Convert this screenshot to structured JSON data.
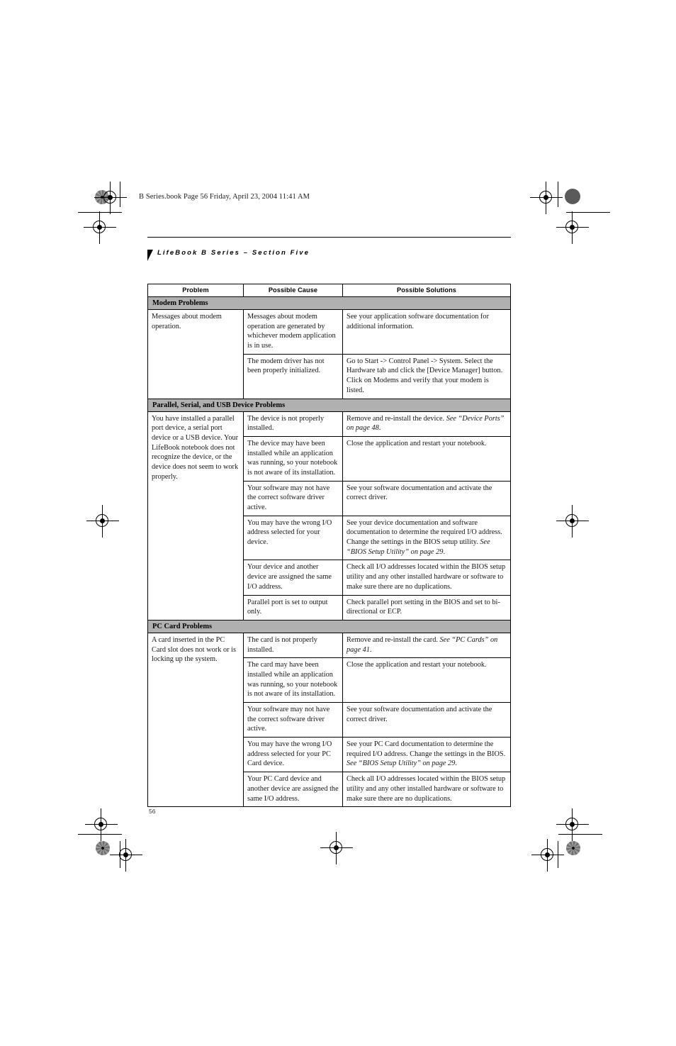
{
  "crop_marks": {
    "book_stamp": "B Series.book  Page 56  Friday, April 23, 2004  11:41 AM"
  },
  "running_head": {
    "text": "LifeBook B Series – Section Five"
  },
  "folio": {
    "page_number": "56"
  },
  "colors": {
    "section_header_fill": "#b0b0b0",
    "rule": "#000000",
    "text": "#161616"
  },
  "table": {
    "headers": {
      "problem": "Problem",
      "cause": "Possible Cause",
      "solution": "Possible Solutions"
    },
    "sections": [
      {
        "title": "Modem Problems",
        "groups": [
          {
            "problem": "Messages about modem operation.",
            "rows": [
              {
                "cause": "Messages about modem operation are generated by whichever modem application is in use.",
                "solution": "See your application software documentation for additional information.",
                "solution_ref": ""
              },
              {
                "cause": "The modem driver has not been properly initialized.",
                "solution": "Go to Start -> Control Panel -> System. Select the Hardware tab and click the [Device Manager] button. Click on Modems and verify that your modem is listed.",
                "solution_ref": ""
              }
            ]
          }
        ]
      },
      {
        "title": "Parallel, Serial, and USB Device Problems",
        "groups": [
          {
            "problem": "You have installed a parallel port device, a serial port device or a USB device. Your LifeBook notebook does not recognize the device, or the device does not seem to work properly.",
            "rows": [
              {
                "cause": "The device is not properly installed.",
                "solution": "Remove and re-install the device. ",
                "solution_ref": "See “Device Ports” on page 48",
                "solution_tail": "."
              },
              {
                "cause": "The device may have been installed while an application was running, so your notebook is not aware of its installation.",
                "solution": "Close the application and restart your notebook.",
                "solution_ref": ""
              },
              {
                "cause": "Your software may not have the correct software driver active.",
                "solution": "See your software documentation and activate the correct driver.",
                "solution_ref": ""
              },
              {
                "cause": "You may have the wrong I/O address selected for your device.",
                "solution": "See your device documentation and software documentation to determine the required I/O address. Change the settings in the BIOS setup utility. ",
                "solution_ref": "See “BIOS Setup Utility” on page 29",
                "solution_tail": "."
              },
              {
                "cause": "Your device and another device are assigned the same I/O address.",
                "solution": "Check all I/O addresses located within the BIOS setup utility and any other installed hardware or software to make sure there are no duplications.",
                "solution_ref": ""
              },
              {
                "cause": "Parallel port is set to output only.",
                "solution": "Check parallel port setting in the BIOS and set to bi-directional or ECP.",
                "solution_ref": ""
              }
            ]
          }
        ]
      },
      {
        "title": "PC Card Problems",
        "groups": [
          {
            "problem": "A card inserted in the PC Card slot does not work or is locking up the system.",
            "rows": [
              {
                "cause": "The card is not properly installed.",
                "solution": "Remove and re-install the card. ",
                "solution_ref": "See “PC Cards” on page 41",
                "solution_tail": "."
              },
              {
                "cause": "The card may have been installed while an application was running, so your notebook is not aware of its installation.",
                "solution": "Close the application and restart your notebook.",
                "solution_ref": ""
              },
              {
                "cause": "Your software may not have the correct software driver active.",
                "solution": "See your software documentation and activate the correct driver.",
                "solution_ref": ""
              },
              {
                "cause": "You may have the wrong I/O address selected for your PC Card device.",
                "solution": "See your PC Card documentation to determine the required I/O address. Change the settings in the BIOS. ",
                "solution_ref": "See “BIOS Setup Utility” on page 29",
                "solution_tail": "."
              },
              {
                "cause": "Your PC Card device and another device are assigned the same I/O address.",
                "solution": "Check all I/O addresses located within the BIOS setup utility and any other installed hardware or software to make sure there are no duplications.",
                "solution_ref": ""
              }
            ]
          }
        ]
      }
    ]
  }
}
